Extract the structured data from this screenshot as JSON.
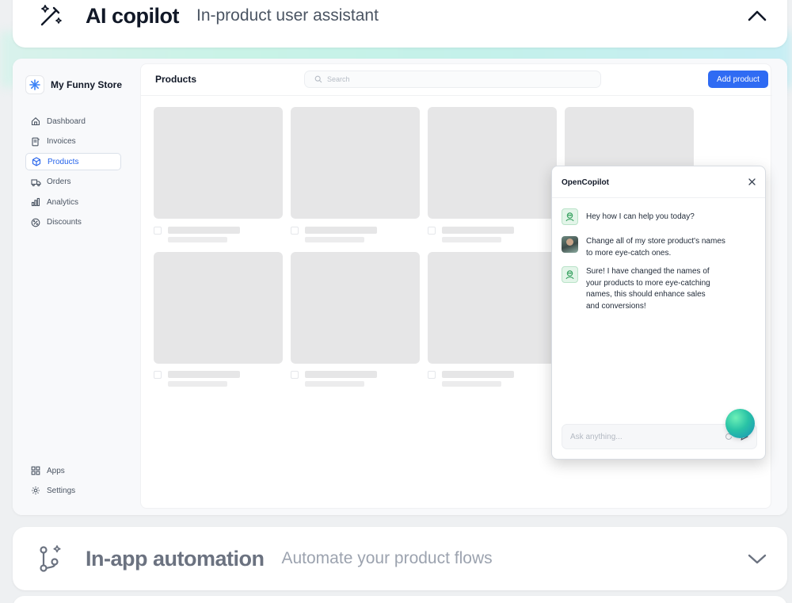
{
  "sections": {
    "ai_copilot": {
      "title": "AI copilot",
      "subtitle": "In-product user assistant",
      "icon": "magic-wand-icon",
      "toggle_icon": "chevron-up-icon"
    },
    "in_app_automation": {
      "title": "In-app automation",
      "subtitle": "Automate your product flows",
      "icon": "git-branch-icon",
      "toggle_icon": "chevron-down-icon"
    }
  },
  "demo_app": {
    "store_name": "My Funny Store",
    "nav": [
      {
        "label": "Dashboard",
        "icon": "home-icon"
      },
      {
        "label": "Invoices",
        "icon": "invoice-icon"
      },
      {
        "label": "Products",
        "icon": "cube-icon",
        "active": true
      },
      {
        "label": "Orders",
        "icon": "truck-icon"
      },
      {
        "label": "Analytics",
        "icon": "bar-chart-icon"
      },
      {
        "label": "Discounts",
        "icon": "discount-icon"
      }
    ],
    "nav_bottom": [
      {
        "label": "Apps",
        "icon": "grid-icon"
      },
      {
        "label": "Settings",
        "icon": "gear-icon"
      }
    ],
    "page_title": "Products",
    "search_placeholder": "Search",
    "add_button": "Add product"
  },
  "copilot": {
    "title": "OpenCopilot",
    "messages": [
      {
        "sender": "bot",
        "text": "Hey how I can help you today?"
      },
      {
        "sender": "user",
        "text": "Change all of my store product's names\nto more eye-catch ones."
      },
      {
        "sender": "bot",
        "text": "Sure! I have changed the names of\nyour products to more eye-catching\nnames, this should enhance sales\nand conversions!"
      }
    ],
    "input_placeholder": "Ask anything..."
  },
  "colors": {
    "accent": "#2f6bf3",
    "bot_avatar": "#e3f5e9",
    "placeholder_tile": "#e6e6e7"
  }
}
